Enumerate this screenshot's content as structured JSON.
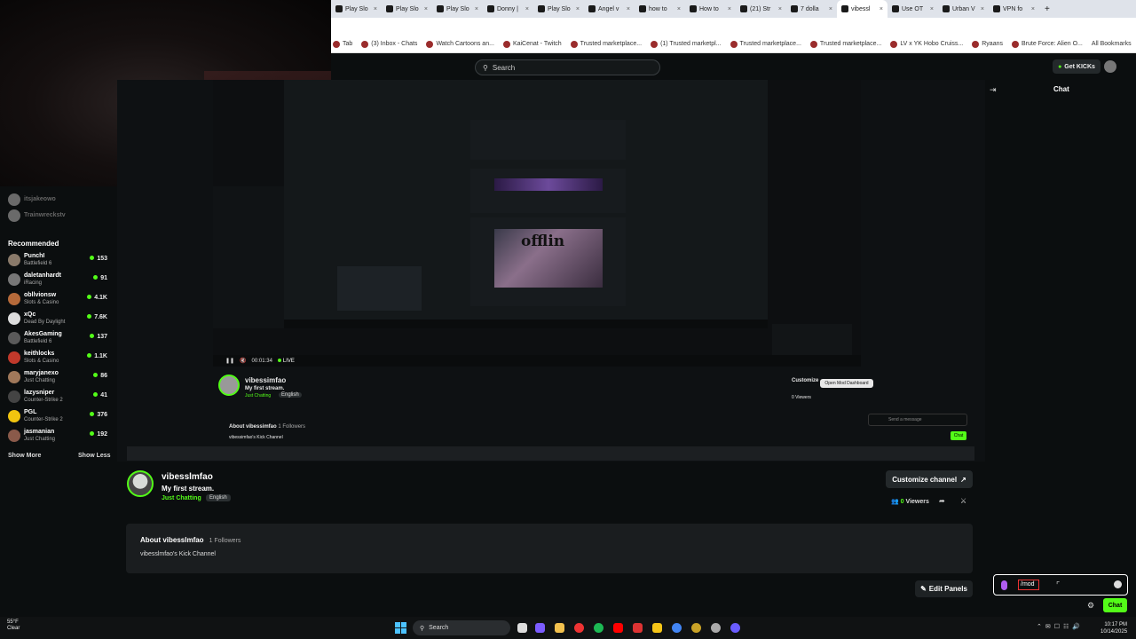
{
  "browser": {
    "tabs": [
      {
        "label": "Play Slo"
      },
      {
        "label": "Play Slo"
      },
      {
        "label": "Play Slo"
      },
      {
        "label": "Donny |"
      },
      {
        "label": "Play Slo"
      },
      {
        "label": "Angel v"
      },
      {
        "label": "how to"
      },
      {
        "label": "How to"
      },
      {
        "label": "(21) Str"
      },
      {
        "label": "7 dolla"
      },
      {
        "label": "vibessl",
        "active": true
      },
      {
        "label": "Use OT"
      },
      {
        "label": "Urban V"
      },
      {
        "label": "VPN fo"
      }
    ],
    "bookmarks": [
      "Tab",
      "(3) Inbox - Chats",
      "Watch Cartoons an...",
      "KaiCenat - Twitch",
      "Trusted marketplace...",
      "(1) Trusted marketpl...",
      "Trusted marketplace...",
      "Trusted marketplace...",
      "LV x YK Hobo Cruiss...",
      "Ryaans",
      "Brute Force: Alien O..."
    ],
    "all_bookmarks": "All Bookmarks"
  },
  "header": {
    "search_placeholder": "Search",
    "get_kicks_label": "Get KICKs"
  },
  "sidebar": {
    "followed": [
      {
        "name": "itsjakeowo"
      },
      {
        "name": "Trainwreckstv"
      }
    ],
    "recommended_title": "Recommended",
    "recommended": [
      {
        "name": "PunchI",
        "category": "Battlefield 6",
        "viewers": "153",
        "avatar_color": "#8a7a6a"
      },
      {
        "name": "daletanhardt",
        "category": "iRacing",
        "viewers": "91",
        "avatar_color": "#777777"
      },
      {
        "name": "obllvionsw",
        "category": "Slots & Casino",
        "viewers": "4.1K",
        "avatar_color": "#b66a3a"
      },
      {
        "name": "xQc",
        "category": "Dead By Daylight",
        "viewers": "7.6K",
        "avatar_color": "#dddddd"
      },
      {
        "name": "AkesGaming",
        "category": "Battlefield 6",
        "viewers": "137",
        "avatar_color": "#5a5a5a"
      },
      {
        "name": "keithlocks",
        "category": "Slots & Casino",
        "viewers": "1.1K",
        "avatar_color": "#c0392b"
      },
      {
        "name": "maryjanexo",
        "category": "Just Chatting",
        "viewers": "86",
        "avatar_color": "#a0785a"
      },
      {
        "name": "lazysniper",
        "category": "Counter-Strike 2",
        "viewers": "41",
        "avatar_color": "#444444"
      },
      {
        "name": "PGL",
        "category": "Counter-Strike 2",
        "viewers": "376",
        "avatar_color": "#f1c40f"
      },
      {
        "name": "jasmanian",
        "category": "Just Chatting",
        "viewers": "192",
        "avatar_color": "#8a5a4a"
      }
    ],
    "show_more": "Show More",
    "show_less": "Show Less"
  },
  "inner_capture": {
    "time": "00:01:34",
    "live": "LIVE",
    "channel_name": "vibessimfao",
    "stream_title": "My first stream.",
    "category": "Just Chatting",
    "language": "English",
    "customize": "Customize",
    "viewers": "0 Viewers",
    "tooltip": "Open Mod Dashboard",
    "about_title": "About vibessimfao",
    "followers": "1 Followers",
    "about_desc": "vibessimfao's Kick Channel",
    "send_placeholder": "Send a message",
    "chat_button": "Chat",
    "offline_text": "offlin"
  },
  "channel": {
    "name": "vibesslmfao",
    "title": "My first stream.",
    "category": "Just Chatting",
    "language": "English",
    "customize_label": "Customize channel",
    "viewers_count": "0",
    "viewers_label": "Viewers",
    "about_title": "About vibesslmfao",
    "followers": "1 Followers",
    "about_desc": "vibesslmfao's Kick Channel",
    "edit_panels": "Edit Panels"
  },
  "chat": {
    "title": "Chat",
    "input_value": "/mod",
    "send_label": "Chat"
  },
  "taskbar": {
    "temp": "55°F",
    "weather": "Clear",
    "search": "Search",
    "time": "10:17 PM",
    "date": "10/14/2025"
  },
  "colors": {
    "accent": "#53fc18",
    "background": "#0b0e0f",
    "panel": "#1a1d1f"
  }
}
